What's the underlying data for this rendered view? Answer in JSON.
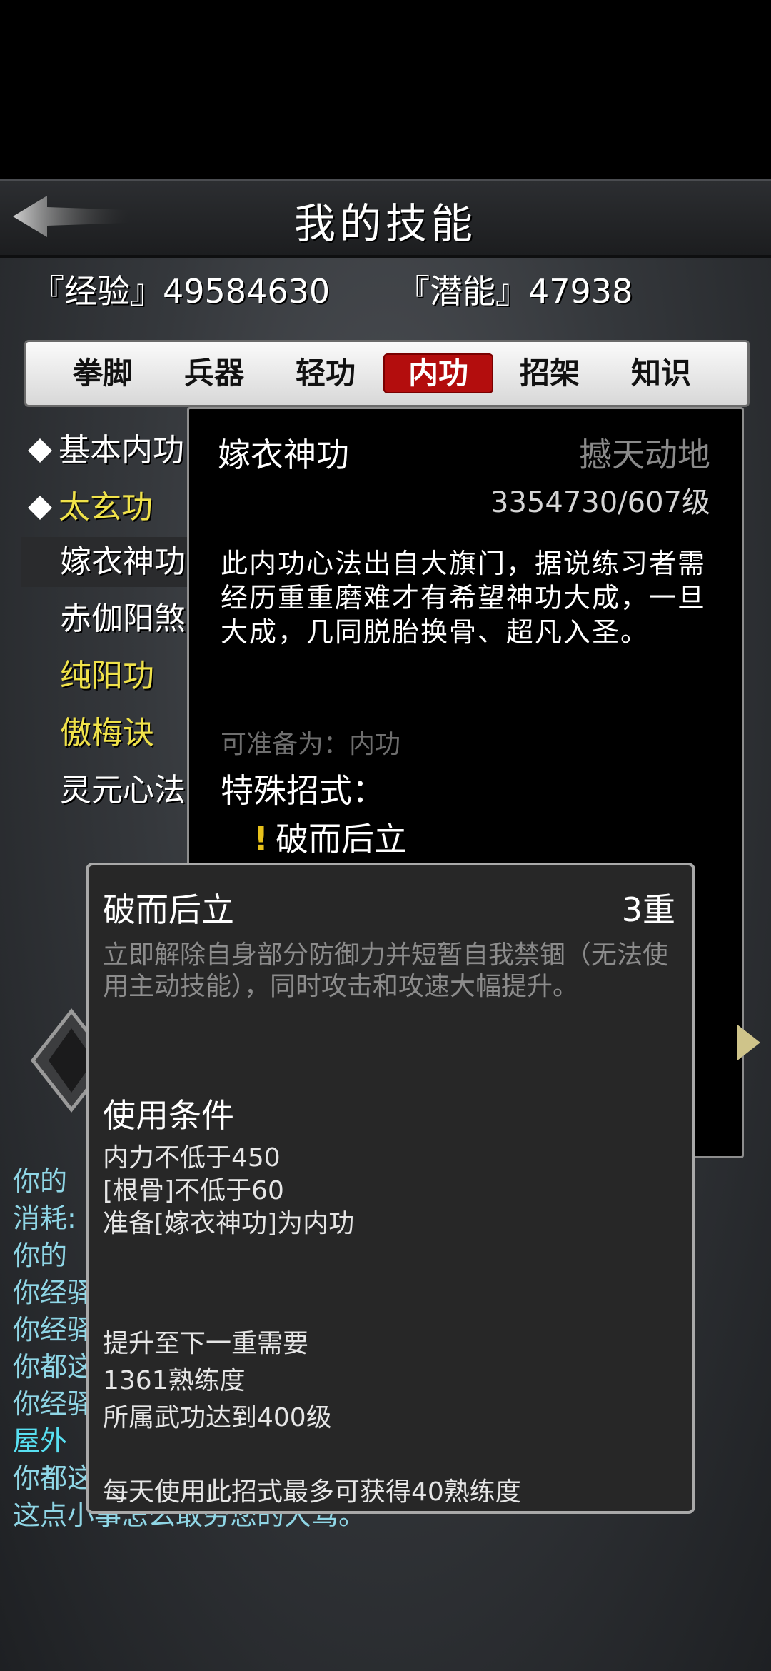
{
  "header": {
    "title": "我的技能"
  },
  "stats": {
    "exp_label": "『经验』49584630",
    "pot_label": "『潜能』47938"
  },
  "tabs": [
    "拳脚",
    "兵器",
    "轻功",
    "内功",
    "招架",
    "知识"
  ],
  "active_tab": "内功",
  "skills": [
    "基本内功",
    "太玄功",
    "嫁衣神功",
    "赤伽阳煞",
    "纯阳功",
    "傲梅诀",
    "灵元心法"
  ],
  "detail": {
    "name": "嫁衣神功",
    "rank": "撼天动地",
    "level": "3354730/607级",
    "description": "此内功心法出自大旗门，据说练习者需经历重重磨难才有希望神功大成，一旦大成，几同脱胎换骨、超凡入圣。",
    "prep": "可准备为：内功",
    "special_label": "特殊招式：",
    "move_bang": "!",
    "move": "破而后立"
  },
  "popup": {
    "title": "破而后立",
    "grade": "3重",
    "description": "立即解除自身部分防御力并短暂自我禁锢（无法使用主动技能），同时攻击和攻速大幅提升。",
    "cond_title": "使用条件",
    "conditions": [
      "内力不低于450",
      "[根骨]不低于60",
      "准备[嫁衣神功]为内功"
    ],
    "upgrade_title": "提升至下一重需要",
    "upgrade": [
      "1361熟练度",
      "所属武功达到400级"
    ],
    "daily": "每天使用此招式最多可获得40熟练度"
  },
  "log": [
    "你的",
    "消耗:",
    "你的",
    "你经驿",
    "你经驿",
    "你都这",
    "你经驿",
    "屋外",
    "你都这",
    "这点小事怎么敢劳您的大驾。"
  ],
  "colors": {
    "active_tab": "#b30d0d",
    "highlight_yellow": "#f0e24a",
    "log_cyan": "#8fd6e6"
  }
}
